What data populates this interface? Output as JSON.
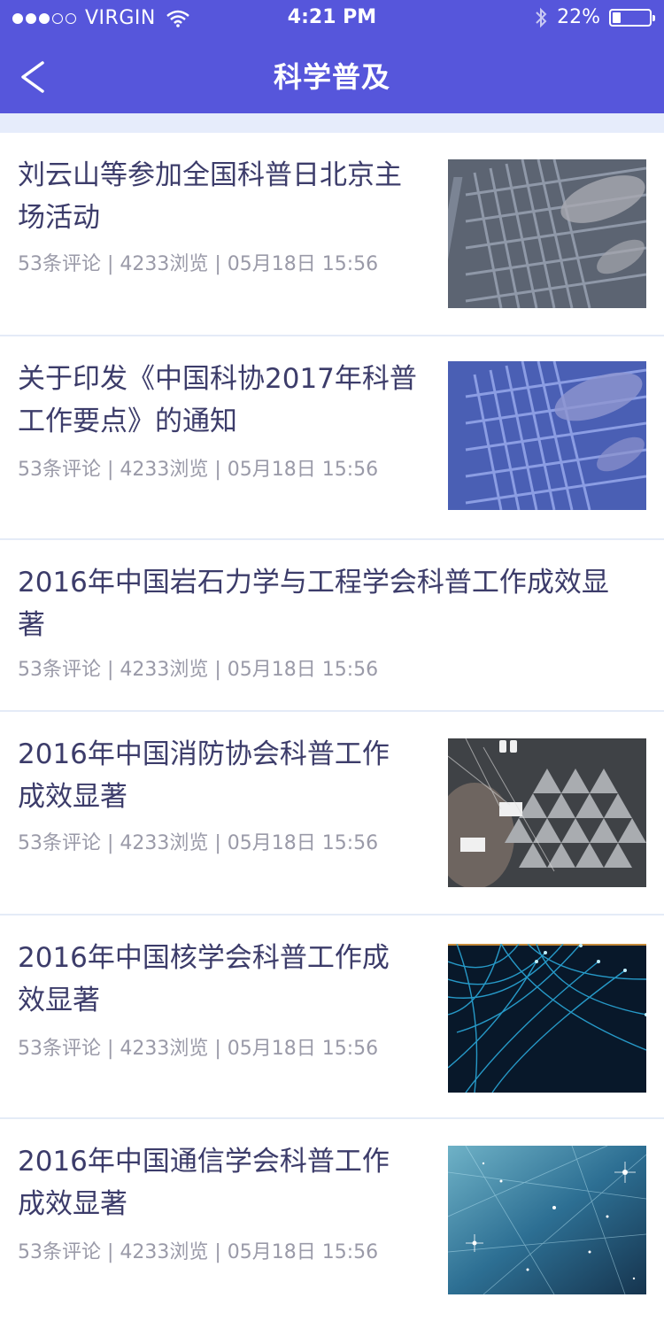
{
  "status": {
    "carrier": "VIRGIN",
    "time": "4:21 PM",
    "battery": "22%",
    "battery_level": 0.22,
    "icons": [
      "signal-dots-icon",
      "wifi-icon",
      "bluetooth-icon",
      "battery-icon"
    ]
  },
  "nav": {
    "title": "科学普及",
    "back_icon": "chevron-left-icon"
  },
  "colors": {
    "header": "#5656db",
    "subbar": "#e6ecfb",
    "title_text": "#3c3c6a",
    "meta_text": "#9a9aa8",
    "divider": "#e4ebf7"
  },
  "articles": [
    {
      "title_line1": "刘云山等参加全国科普日北京主",
      "title_line2": "场活动",
      "meta": "53条评论 | 4233浏览 | 05月18日 15:56",
      "image": "keyboard-gray"
    },
    {
      "title_line1": "关于印发《中国科协2017年科普",
      "title_line2": "工作要点》的通知",
      "meta": "53条评论 | 4233浏览 | 05月18日 15:56",
      "image": "keyboard-blue"
    },
    {
      "title_line1": "2016年中国岩石力学与工程学会科普工作成效显",
      "title_line2": "著",
      "meta": "53条评论 | 4233浏览 | 05月18日 15:56",
      "image": "none"
    },
    {
      "title_line1": "2016年中国消防协会科普工作",
      "title_line2": "成效显著",
      "meta": "53条评论 | 4233浏览 | 05月18日 15:56",
      "image": "tech-triangles"
    },
    {
      "title_line1": "2016年中国核学会科普工作成",
      "title_line2": "效显著",
      "meta": "53条评论 | 4233浏览 | 05月18日 15:56",
      "image": "fiber-optics"
    },
    {
      "title_line1": "2016年中国通信学会科普工作",
      "title_line2": "成效显著",
      "meta": "53条评论 | 4233浏览 | 05月18日 15:56",
      "image": "network-stars"
    }
  ]
}
